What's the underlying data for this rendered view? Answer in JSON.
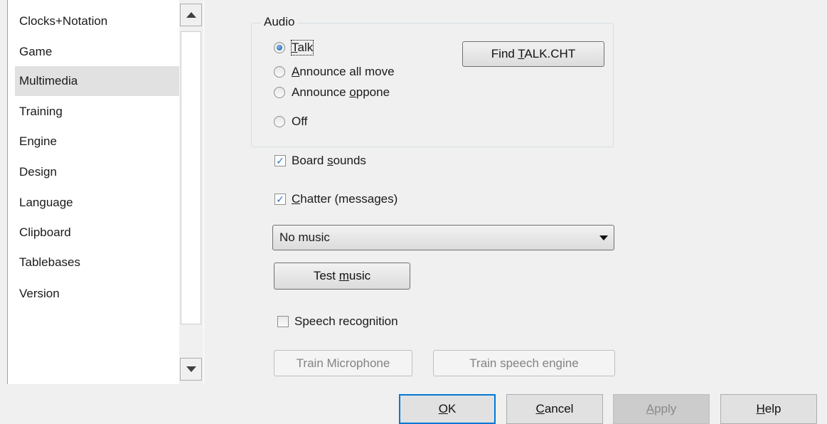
{
  "categories": [
    {
      "label": "Clocks+Notation",
      "selected": false
    },
    {
      "label": "Game",
      "selected": false
    },
    {
      "label": "Multimedia",
      "selected": true
    },
    {
      "label": "Training",
      "selected": false
    },
    {
      "label": "Engine",
      "selected": false
    },
    {
      "label": "Design",
      "selected": false
    },
    {
      "label": "Language",
      "selected": false
    },
    {
      "label": "Clipboard",
      "selected": false
    },
    {
      "label": "Tablebases",
      "selected": false
    },
    {
      "label": "Version",
      "selected": false
    }
  ],
  "audio": {
    "legend": "Audio",
    "options": [
      {
        "pre": "",
        "mn": "T",
        "post": "alk",
        "checked": true
      },
      {
        "pre": "",
        "mn": "A",
        "post": "nnounce all move",
        "checked": false
      },
      {
        "pre": "Announce ",
        "mn": "o",
        "post": "ppone",
        "checked": false
      },
      {
        "pre": "Off",
        "mn": "",
        "post": "",
        "checked": false
      }
    ],
    "find_button": {
      "pre": "Find ",
      "mn": "T",
      "post": "ALK.CHT"
    }
  },
  "board_sounds": {
    "pre": "Board ",
    "mn": "s",
    "post": "ounds",
    "checked": true
  },
  "chatter": {
    "pre": "",
    "mn": "C",
    "post": "hatter (messages)",
    "checked": true
  },
  "music_select": {
    "value": "No music"
  },
  "test_music": {
    "pre": "Test ",
    "mn": "m",
    "post": "usic"
  },
  "speech_recognition": {
    "label": "Speech recognition",
    "checked": false
  },
  "train_microphone": {
    "label": "Train Microphone",
    "enabled": false
  },
  "train_speech_engine": {
    "label": "Train speech engine",
    "enabled": false
  },
  "footer": {
    "ok": {
      "pre": "",
      "mn": "O",
      "post": "K"
    },
    "cancel": {
      "pre": "",
      "mn": "C",
      "post": "ancel"
    },
    "apply": {
      "pre": "",
      "mn": "A",
      "post": "pply"
    },
    "help": {
      "pre": "",
      "mn": "H",
      "post": "elp"
    }
  },
  "icons": {
    "scroll_up": "triangle-up",
    "scroll_down": "triangle-down",
    "dropdown": "triangle-down",
    "check": "✓"
  }
}
